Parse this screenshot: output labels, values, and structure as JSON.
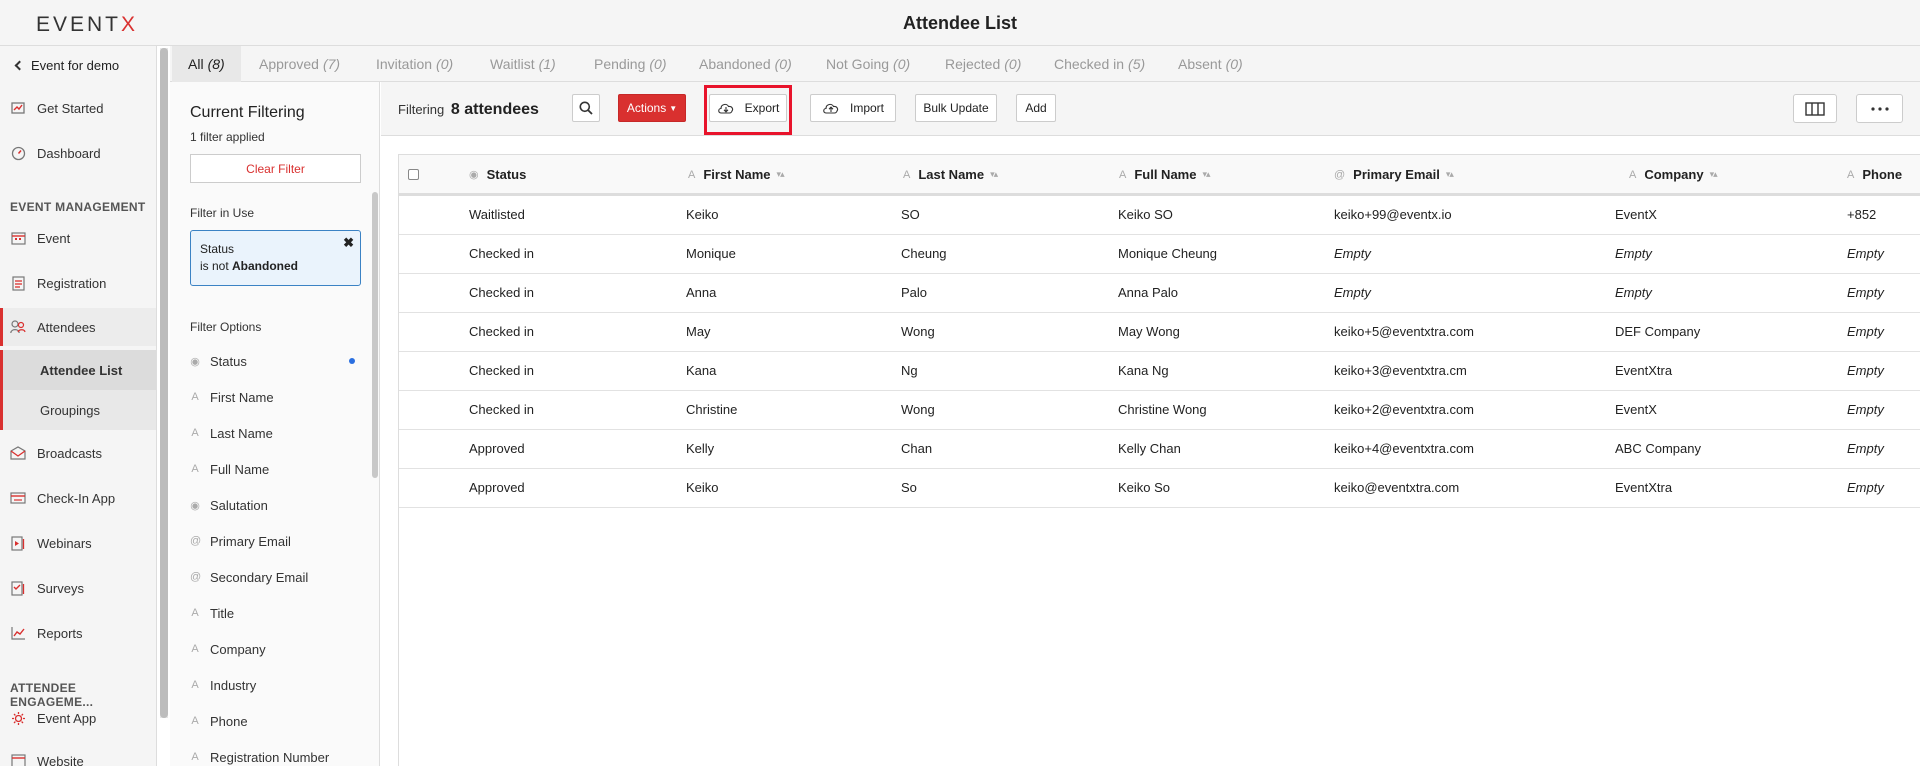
{
  "header": {
    "logo_main": "EVENT",
    "logo_x": "X",
    "title": "Attendee List"
  },
  "sidebar": {
    "back_label": "Event for demo",
    "items_top": [
      {
        "label": "Get Started",
        "icon": "flag-chart-icon"
      },
      {
        "label": "Dashboard",
        "icon": "gauge-icon"
      }
    ],
    "section_event_mgmt": "EVENT MANAGEMENT",
    "items_mgmt": [
      {
        "label": "Event",
        "icon": "calendar-icon"
      },
      {
        "label": "Registration",
        "icon": "form-icon"
      },
      {
        "label": "Attendees",
        "icon": "users-icon"
      }
    ],
    "subitems": [
      {
        "label": "Attendee List"
      },
      {
        "label": "Groupings"
      }
    ],
    "items_mgmt2": [
      {
        "label": "Broadcasts",
        "icon": "mail-icon"
      },
      {
        "label": "Check-In App",
        "icon": "checkin-icon"
      },
      {
        "label": "Webinars",
        "icon": "webinar-icon"
      },
      {
        "label": "Surveys",
        "icon": "survey-icon"
      },
      {
        "label": "Reports",
        "icon": "report-icon"
      }
    ],
    "section_engagement": "ATTENDEE ENGAGEME...",
    "items_engagement": [
      {
        "label": "Event App",
        "icon": "app-icon"
      },
      {
        "label": "Website",
        "icon": "website-icon"
      }
    ]
  },
  "tabs": [
    {
      "label": "All",
      "count": "(8)"
    },
    {
      "label": "Approved",
      "count": "(7)"
    },
    {
      "label": "Invitation",
      "count": "(0)"
    },
    {
      "label": "Waitlist",
      "count": "(1)"
    },
    {
      "label": "Pending",
      "count": "(0)"
    },
    {
      "label": "Abandoned",
      "count": "(0)"
    },
    {
      "label": "Not Going",
      "count": "(0)"
    },
    {
      "label": "Rejected",
      "count": "(0)"
    },
    {
      "label": "Checked in",
      "count": "(5)"
    },
    {
      "label": "Absent",
      "count": "(0)"
    }
  ],
  "filter_panel": {
    "title": "Current Filtering",
    "applied": "1 filter applied",
    "clear_label": "Clear Filter",
    "in_use_label": "Filter in Use",
    "chip_line1": "Status",
    "chip_line2_prefix": "is not ",
    "chip_line2_value": "Abandoned",
    "options_label": "Filter Options",
    "options": [
      {
        "label": "Status",
        "icon": "radio"
      },
      {
        "label": "First Name",
        "icon": "text"
      },
      {
        "label": "Last Name",
        "icon": "text"
      },
      {
        "label": "Full Name",
        "icon": "text"
      },
      {
        "label": "Salutation",
        "icon": "radio"
      },
      {
        "label": "Primary Email",
        "icon": "at"
      },
      {
        "label": "Secondary Email",
        "icon": "at"
      },
      {
        "label": "Title",
        "icon": "text"
      },
      {
        "label": "Company",
        "icon": "text"
      },
      {
        "label": "Industry",
        "icon": "text"
      },
      {
        "label": "Phone",
        "icon": "text"
      },
      {
        "label": "Registration Number",
        "icon": "text"
      }
    ]
  },
  "toolbar": {
    "filtering_label": "Filtering",
    "filtering_count": "8 attendees",
    "actions_label": "Actions",
    "export_label": "Export",
    "import_label": "Import",
    "bulk_update_label": "Bulk Update",
    "add_label": "Add"
  },
  "table": {
    "columns": [
      "Status",
      "First Name",
      "Last Name",
      "Full Name",
      "Primary Email",
      "Company",
      "Phone"
    ],
    "rows": [
      [
        "Waitlisted",
        "Keiko",
        "SO",
        "Keiko SO",
        "keiko+99@eventx.io",
        "EventX",
        "+852"
      ],
      [
        "Checked in",
        "Monique",
        "Cheung",
        "Monique Cheung",
        "Empty",
        "Empty",
        "Empty"
      ],
      [
        "Checked in",
        "Anna",
        "Palo",
        "Anna Palo",
        "Empty",
        "Empty",
        "Empty"
      ],
      [
        "Checked in",
        "May",
        "Wong",
        "May Wong",
        "keiko+5@eventxtra.com",
        "DEF Company",
        "Empty"
      ],
      [
        "Checked in",
        "Kana",
        "Ng",
        "Kana Ng",
        "keiko+3@eventxtra.cm",
        "EventXtra",
        "Empty"
      ],
      [
        "Checked in",
        "Christine",
        "Wong",
        "Christine Wong",
        "keiko+2@eventxtra.com",
        "EventX",
        "Empty"
      ],
      [
        "Approved",
        "Kelly",
        "Chan",
        "Kelly Chan",
        "keiko+4@eventxtra.com",
        "ABC Company",
        "Empty"
      ],
      [
        "Approved",
        "Keiko",
        "So",
        "Keiko So",
        "keiko@eventxtra.com",
        "EventXtra",
        "Empty"
      ]
    ]
  },
  "colors": {
    "accent": "#d9302f",
    "chip_border": "#3b82c4",
    "export_highlight": "#e8132b"
  }
}
